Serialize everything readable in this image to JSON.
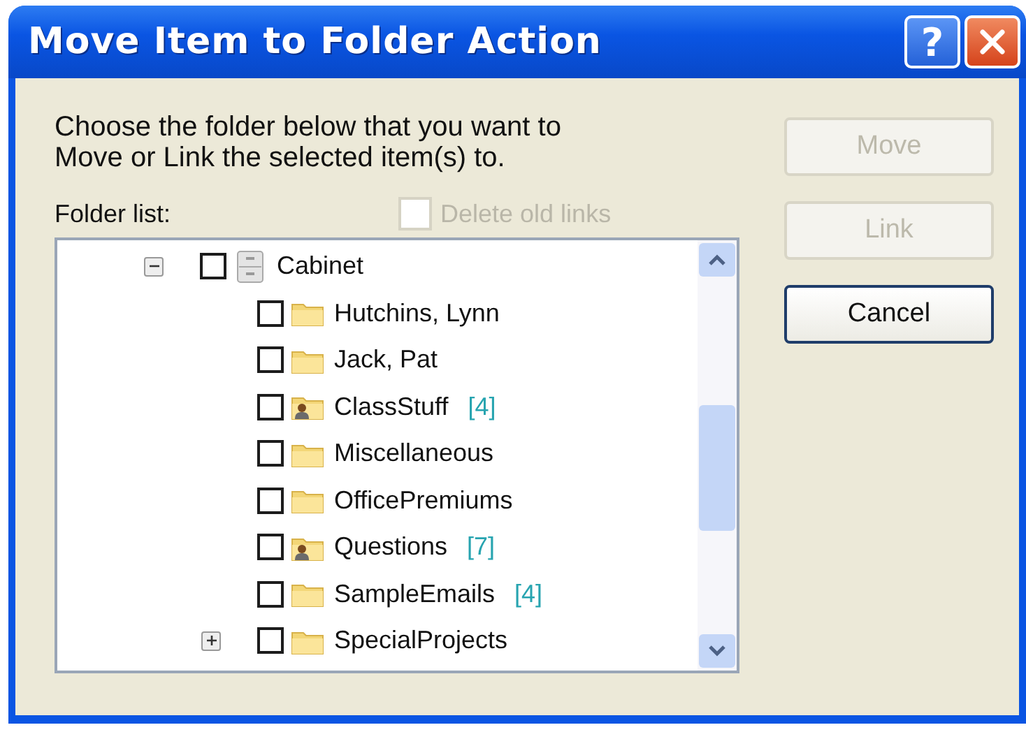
{
  "window": {
    "title": "Move Item to Folder Action",
    "help_button": "?"
  },
  "instructions": "Choose the folder below that you want to Move or Link the selected item(s) to.",
  "folder_list_label": "Folder list:",
  "delete_old_links": {
    "label": "Delete old links",
    "checked": false,
    "disabled": true
  },
  "tree": [
    {
      "label": "Cabinet",
      "kind": "cabinet",
      "checked": false,
      "expanded": true,
      "children": [
        {
          "label": "Hutchins, Lynn",
          "kind": "folder",
          "checked": false
        },
        {
          "label": "Jack, Pat",
          "kind": "folder",
          "checked": false
        },
        {
          "label": "ClassStuff",
          "count": "[4]",
          "kind": "shared",
          "checked": false
        },
        {
          "label": "Miscellaneous",
          "kind": "folder",
          "checked": false
        },
        {
          "label": "OfficePremiums",
          "kind": "folder",
          "checked": false
        },
        {
          "label": "Questions",
          "count": "[7]",
          "kind": "shared",
          "checked": false
        },
        {
          "label": "SampleEmails",
          "count": "[4]",
          "kind": "folder",
          "checked": false
        },
        {
          "label": "SpecialProjects",
          "kind": "folder",
          "checked": false,
          "expanded": false
        }
      ]
    }
  ],
  "buttons": [
    {
      "label": "Move",
      "disabled": true
    },
    {
      "label": "Link",
      "disabled": true
    },
    {
      "label": "Cancel",
      "disabled": false
    }
  ]
}
